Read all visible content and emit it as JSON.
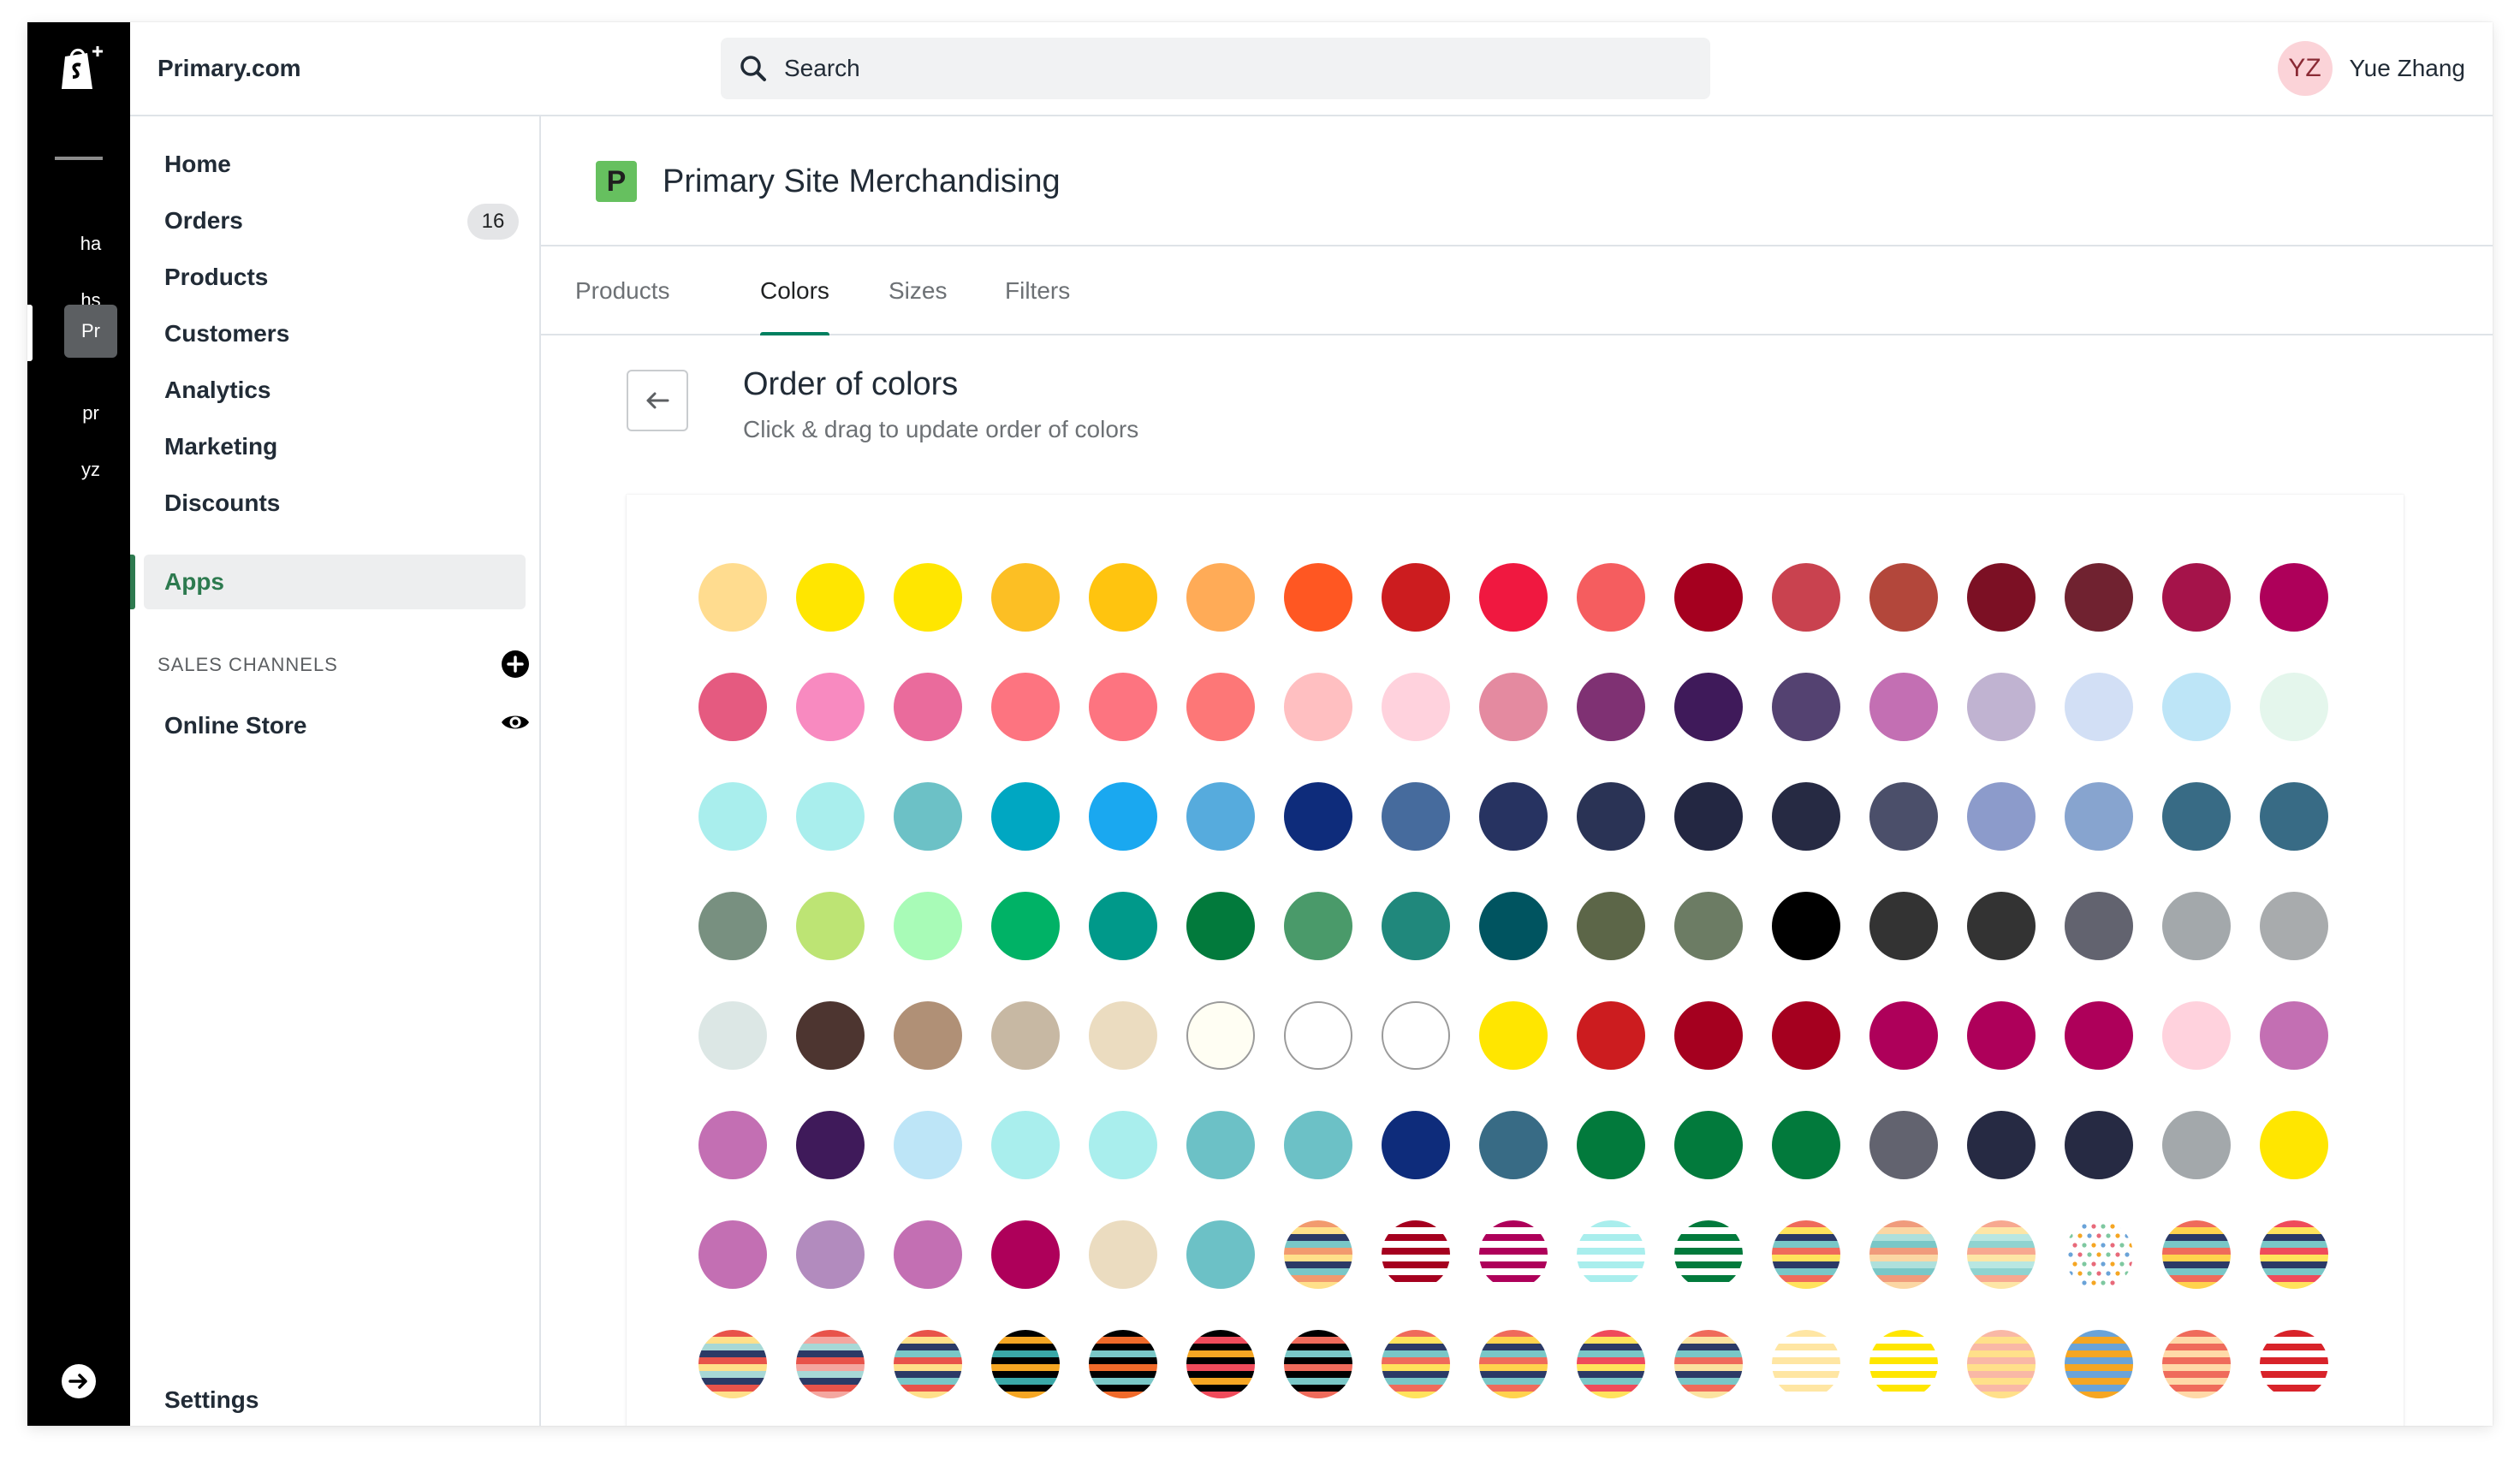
{
  "rail": {
    "items": [
      "ha",
      "hs",
      "Pr",
      "pr",
      "yz"
    ],
    "active_index": 2,
    "icons": {
      "logo": "shopify-bag-icon",
      "exit": "arrow-right-circle-icon"
    }
  },
  "topbar": {
    "store_name": "Primary.com",
    "search_placeholder": "Search",
    "user": {
      "initials": "YZ",
      "name": "Yue Zhang"
    }
  },
  "sidebar": {
    "items": [
      {
        "label": "Home",
        "name": "home"
      },
      {
        "label": "Orders",
        "name": "orders",
        "badge": "16"
      },
      {
        "label": "Products",
        "name": "products"
      },
      {
        "label": "Customers",
        "name": "customers"
      },
      {
        "label": "Analytics",
        "name": "analytics"
      },
      {
        "label": "Marketing",
        "name": "marketing"
      },
      {
        "label": "Discounts",
        "name": "discounts"
      },
      {
        "label": "Apps",
        "name": "apps",
        "active": true
      }
    ],
    "sales_channels_heading": "SALES CHANNELS",
    "online_store": "Online Store",
    "settings": "Settings"
  },
  "app": {
    "logo_letter": "P",
    "title": "Primary Site Merchandising",
    "tabs": [
      "Products",
      "Colors",
      "Sizes",
      "Filters"
    ],
    "active_tab": 1
  },
  "page": {
    "title": "Order of colors",
    "subtitle": "Click & drag to update order of colors"
  },
  "theme": {
    "accent": "#008060",
    "active_nav_text": "#2d7a4f",
    "rail_bg": "#000000"
  },
  "swatches": [
    [
      "#ffdc8f",
      "#ffe600",
      "#ffe600",
      "#fcbf24",
      "#ffc40f",
      "#ffab57",
      "#ff5722",
      "#cc1c1f",
      "#f01840",
      "#f55d5f",
      "#a5001f",
      "#c9424f",
      "#b3473b",
      "#7c1024",
      "#702230",
      "#a5134a",
      "#ae005a"
    ],
    [
      "#e55a80",
      "#f88ac0",
      "#ea6b9c",
      "#fd7480",
      "#fd7480",
      "#fd7777",
      "#ffbfc1",
      "#ffd2dd",
      "#e48aa0",
      "#7f3173",
      "#3f1a5a",
      "#544271",
      "#c36fb3",
      "#c0b3d1",
      "#d2dff5",
      "#bde5f7",
      "#e4f6ec"
    ],
    [
      "#a9eeed",
      "#a9eeed",
      "#6cc1c6",
      "#00a7c2",
      "#1aa8f0",
      "#56abdd",
      "#0e2c7b",
      "#466b9d",
      "#273361",
      "#2a3355",
      "#232742",
      "#262a43",
      "#4b4f6a",
      "#8c9bcb",
      "#87a4cf",
      "#386b85",
      "#386b85"
    ],
    [
      "#789080",
      "#bde474",
      "#a8fbb7",
      "#00b266",
      "#00998a",
      "#027a3c",
      "#4a9a6a",
      "#20887c",
      "#005460",
      "#5c6648",
      "#6c7c64",
      "#000000",
      "#333333",
      "#333333",
      "#62636f",
      "#a3a8ab",
      "#a8abad"
    ],
    [
      "#dce7e5",
      "#4d3530",
      "#b09076",
      "#c7b8a3",
      "#ebdcc0",
      "#fffef3",
      "#ffffff",
      "#ffffff",
      "#ffe600",
      "#cc1c1f",
      "#a5001f",
      "#a5001f",
      "#ae005a",
      "#ae005a",
      "#ae005a",
      "#ffd2dd",
      "#c36fb3"
    ],
    [
      "#c36fb3",
      "#3f1a5a",
      "#bde5f7",
      "#a9eeed",
      "#a9eeed",
      "#6cc1c6",
      "#6cc1c6",
      "#0e2c7b",
      "#386b85",
      "#027a3c",
      "#027a3c",
      "#027a3c",
      "#62636f",
      "#262a43",
      "#262a43",
      "#a3a8ab",
      "#ffe600"
    ],
    [
      "#c36fb3",
      "#b28bbe",
      "#c36fb3",
      "#ae005a",
      "#ebdcc0",
      "#6cc1c6",
      "stripe:#f29a6e,#ffe08a,#2b3a66,#79c7c7",
      "stripe:#a5001f,#ffffff,#a5001f,#ffffff",
      "stripe:#ae005a,#ffffff,#ae005a,#ffffff",
      "stripe:#a9eeed,#ffffff,#a9eeed,#ffffff",
      "stripe:#027a3c,#ffffff,#027a3c,#ffffff",
      "stripe:#ef6b5b,#ffe35c,#2b3a66,#79c7c7",
      "stripe:#f09b7c,#fbd7a4,#aee0dc,#79c7c7",
      "stripe:#f7a890,#fde6a6,#b8e7e2,#8fd3d0",
      "dots:#f5a623,#7ec8a0,#e86a7a,#6aa3d8",
      "stripe:#ef6b5b,#ffd34d,#2b3a66,#79c7c7",
      "stripe:#ef4b5b,#ffe35c,#2b3a66,#79c7c7"
    ],
    [
      "stripe:#e8534a,#ffe08a,#a7d8d6,#2b3a66",
      "stripe:#e8534a,#f4a7a0,#a7d8d6,#2b3a66",
      "stripe:#e8534a,#ffe08a,#2b3a66,#79c7c7",
      "stripe:#000000,#f5a623,#000000,#3aa8a8",
      "stripe:#000000,#f06a2a,#000000,#79c7c7",
      "stripe:#000000,#ef4b5b,#000000,#f5a623",
      "stripe:#000000,#ef6b5b,#000000,#79c7c7",
      "stripe:#ef6b5b,#ffe35c,#2b3a66,#79c7c7",
      "stripe:#ef6b5b,#ffd34d,#2b3a66,#79c7c7",
      "stripe:#ef4b5b,#ffe35c,#2b3a66,#79c7c7",
      "stripe:#ef6b5b,#fbe3a0,#2b3a66,#79c7c7",
      "stripe:#ffe6a3,#ffffff,#ffe6a3,#ffffff",
      "stripe:#ffe600,#ffffff,#ffe600,#ffffff",
      "stripe:#f9b8a6,#ffe08a,#f9b8a6,#ffe08a",
      "stripe:#6aa3d8,#f5a623,#6aa3d8,#f5a623",
      "stripe:#ef6b5b,#ffd9a8,#ef6b5b,#ffd9a8",
      "stripe:#d8232a,#ffffff,#d8232a,#ffffff"
    ]
  ]
}
